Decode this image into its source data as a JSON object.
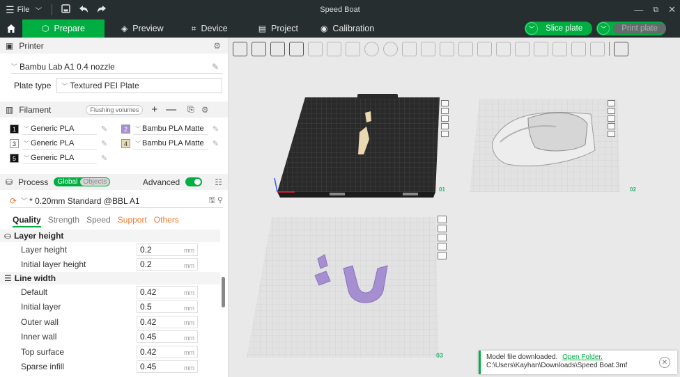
{
  "titlebar": {
    "menu_label": "File",
    "title": "Speed Boat"
  },
  "nav": {
    "tabs": [
      {
        "label": "Prepare"
      },
      {
        "label": "Preview"
      },
      {
        "label": "Device"
      },
      {
        "label": "Project"
      },
      {
        "label": "Calibration"
      }
    ],
    "slice_label": "Slice plate",
    "print_label": "Print plate"
  },
  "printer": {
    "section_label": "Printer",
    "model": "Bambu Lab A1 0.4 nozzle",
    "plate_type_label": "Plate type",
    "plate_type_value": "Textured PEI Plate"
  },
  "filament": {
    "section_label": "Filament",
    "flushing_label": "Flushing volumes",
    "items": [
      {
        "num": "1",
        "name": "Generic PLA",
        "color": "#111111",
        "text_color": "#ffffff"
      },
      {
        "num": "2",
        "name": "Bambu PLA Matte",
        "color": "#a58fd0",
        "text_color": "#ffffff"
      },
      {
        "num": "3",
        "name": "Generic PLA",
        "color": "#ffffff",
        "text_color": "#333333"
      },
      {
        "num": "4",
        "name": "Bambu PLA Matte",
        "color": "#e9d9b0",
        "text_color": "#333333"
      },
      {
        "num": "5",
        "name": "Generic PLA",
        "color": "#111111",
        "text_color": "#ffffff"
      }
    ]
  },
  "process": {
    "section_label": "Process",
    "global_label": "Global",
    "objects_label": "Objects",
    "advanced_label": "Advanced",
    "preset": "* 0.20mm Standard @BBL A1",
    "tabs": [
      "Quality",
      "Strength",
      "Speed",
      "Support",
      "Others"
    ],
    "groups": [
      {
        "label": "Layer height",
        "rows": [
          {
            "label": "Layer height",
            "value": "0.2",
            "unit": "mm"
          },
          {
            "label": "Initial layer height",
            "value": "0.2",
            "unit": "mm"
          }
        ]
      },
      {
        "label": "Line width",
        "rows": [
          {
            "label": "Default",
            "value": "0.42",
            "unit": "mm"
          },
          {
            "label": "Initial layer",
            "value": "0.5",
            "unit": "mm"
          },
          {
            "label": "Outer wall",
            "value": "0.42",
            "unit": "mm"
          },
          {
            "label": "Inner wall",
            "value": "0.45",
            "unit": "mm"
          },
          {
            "label": "Top surface",
            "value": "0.42",
            "unit": "mm"
          },
          {
            "label": "Sparse infill",
            "value": "0.45",
            "unit": "mm"
          }
        ]
      }
    ]
  },
  "plates": {
    "labels": [
      "01",
      "02",
      "03"
    ]
  },
  "notification": {
    "message": "Model file downloaded.",
    "link": "Open Folder.",
    "path": "C:\\Users\\Kayhan\\Downloads\\Speed Boat.3mf"
  },
  "colors": {
    "accent": "#00ae42",
    "dark_bar": "#262e30",
    "support_orange": "#f0782d",
    "model_purple": "#a58fd0",
    "model_beige": "#e9d9b0"
  }
}
